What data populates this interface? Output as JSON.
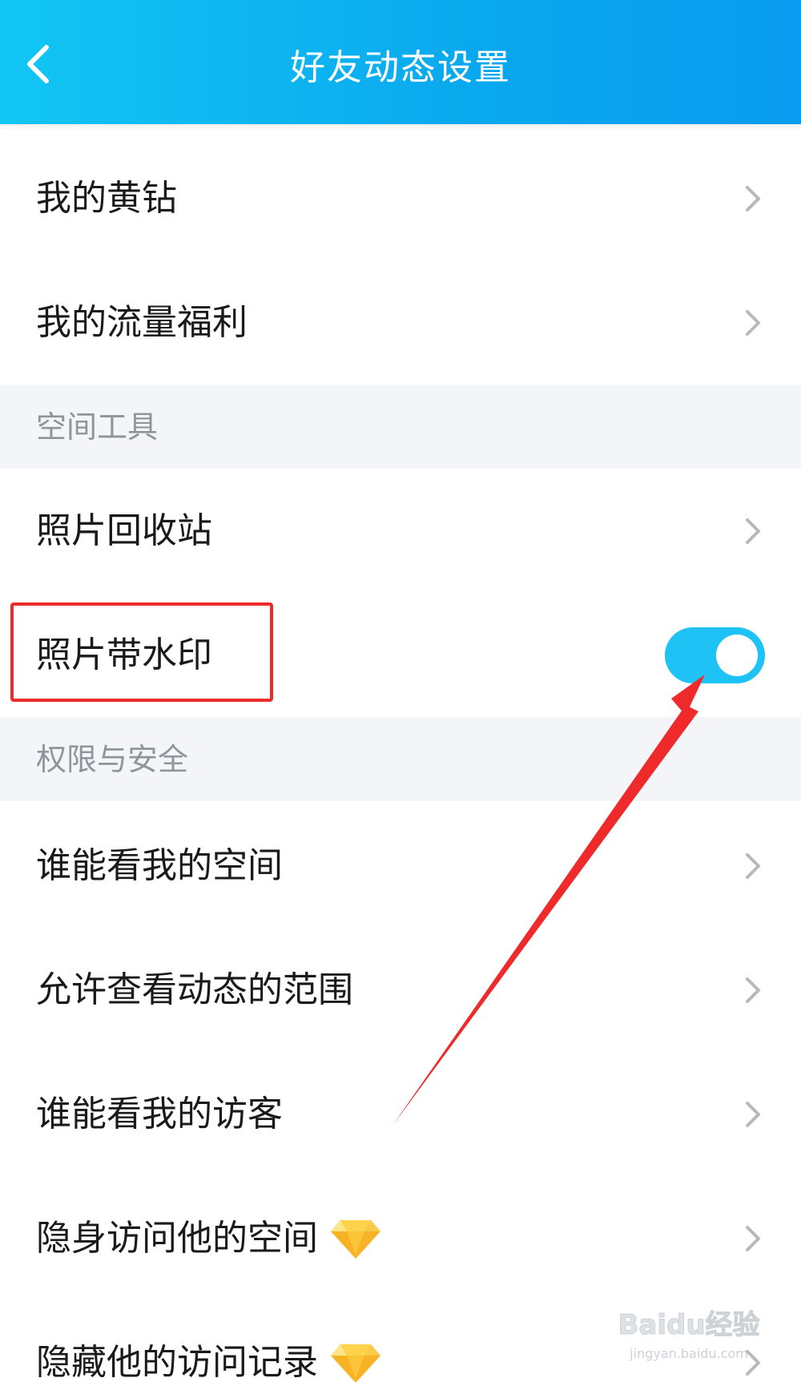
{
  "header": {
    "title": "好友动态设置",
    "back_icon": "chevron-left-icon"
  },
  "colors": {
    "header_start": "#12c6f4",
    "header_end": "#0a9cf0",
    "toggle_on": "#1ec2f4",
    "section_bg": "#f3f5f8",
    "annotation_red": "#ee2a2a"
  },
  "rows_group1": [
    {
      "label": "我的黄钻"
    },
    {
      "label": "我的流量福利"
    }
  ],
  "section_tools": {
    "label": "空间工具"
  },
  "rows_tools": [
    {
      "label": "照片回收站"
    },
    {
      "label": "照片带水印",
      "toggle": "on"
    }
  ],
  "section_privacy": {
    "label": "权限与安全"
  },
  "rows_privacy": [
    {
      "label": "谁能看我的空间"
    },
    {
      "label": "允许查看动态的范围"
    },
    {
      "label": "谁能看我的访客"
    },
    {
      "label": "隐身访问他的空间",
      "badge_icon": "yellow-diamond-icon"
    },
    {
      "label": "隐藏他的访问记录",
      "badge_icon": "yellow-diamond-icon"
    }
  ],
  "watermark": {
    "text": "Baidu经验",
    "subtext": "jingyan.baidu.com"
  }
}
